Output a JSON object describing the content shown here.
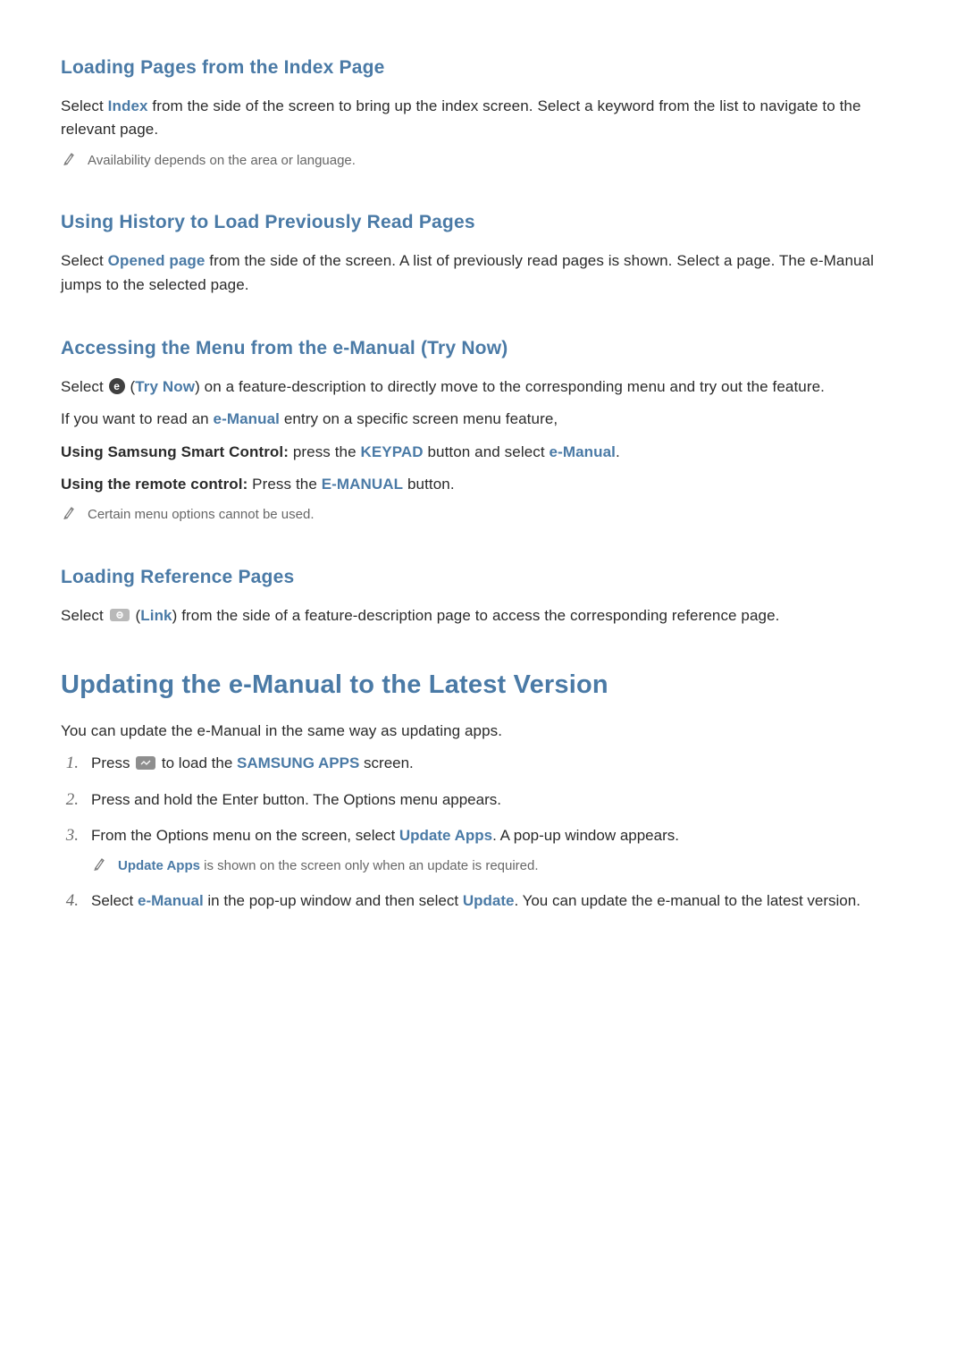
{
  "s1": {
    "title": "Loading Pages from the Index Page",
    "p_a": "Select ",
    "p_hl": "Index",
    "p_b": " from the side of the screen to bring up the index screen. Select a keyword from the list to navigate to the relevant page.",
    "note": "Availability depends on the area or language."
  },
  "s2": {
    "title": "Using History to Load Previously Read Pages",
    "p_a": "Select ",
    "p_hl": "Opened page",
    "p_b": " from the side of the screen. A list of previously read pages is shown. Select a page. The e-Manual jumps to the selected page."
  },
  "s3": {
    "title": "Accessing the Menu from the e-Manual (Try Now)",
    "p1_a": "Select ",
    "p1_hl": "Try Now",
    "p1_b": ") on a feature-description to directly move to the corresponding menu and try out the feature.",
    "p2_a": "If you want to read an ",
    "p2_hl": "e-Manual",
    "p2_b": " entry on a specific screen menu feature,",
    "p3_bold": "Using Samsung Smart Control:",
    "p3_a": " press the ",
    "p3_hl1": "KEYPAD",
    "p3_b": " button and select ",
    "p3_hl2": "e-Manual",
    "p3_c": ".",
    "p4_bold": "Using the remote control:",
    "p4_a": " Press the ",
    "p4_hl": "E-MANUAL",
    "p4_b": " button.",
    "note": "Certain menu options cannot be used."
  },
  "s4": {
    "title": "Loading Reference Pages",
    "p_a": "Select ",
    "p_hl": "Link",
    "p_b": ") from the side of a feature-description page to access the corresponding reference page."
  },
  "h2": "Updating the e-Manual to the Latest Version",
  "h2_intro": "You can update the e-Manual in the same way as updating apps.",
  "step1": {
    "num": "1.",
    "a": "Press ",
    "b": " to load the ",
    "hl": "SAMSUNG APPS",
    "c": " screen."
  },
  "step2": {
    "num": "2.",
    "txt": "Press and hold the Enter button. The Options menu appears."
  },
  "step3": {
    "num": "3.",
    "a": "From the Options menu on the screen, select ",
    "hl": "Update Apps",
    "b": ". A pop-up window appears.",
    "note_hl": "Update Apps",
    "note_b": " is shown on the screen only when an update is required."
  },
  "step4": {
    "num": "4.",
    "a": "Select ",
    "hl1": "e-Manual",
    "b": " in the pop-up window and then select ",
    "hl2": "Update",
    "c": ". You can update the e-manual to the latest version."
  },
  "icons": {
    "pencil": "pencil-note-icon",
    "try_pill": "e",
    "link_chip": "link-icon",
    "hub_chip": "smart-hub-button-icon"
  }
}
